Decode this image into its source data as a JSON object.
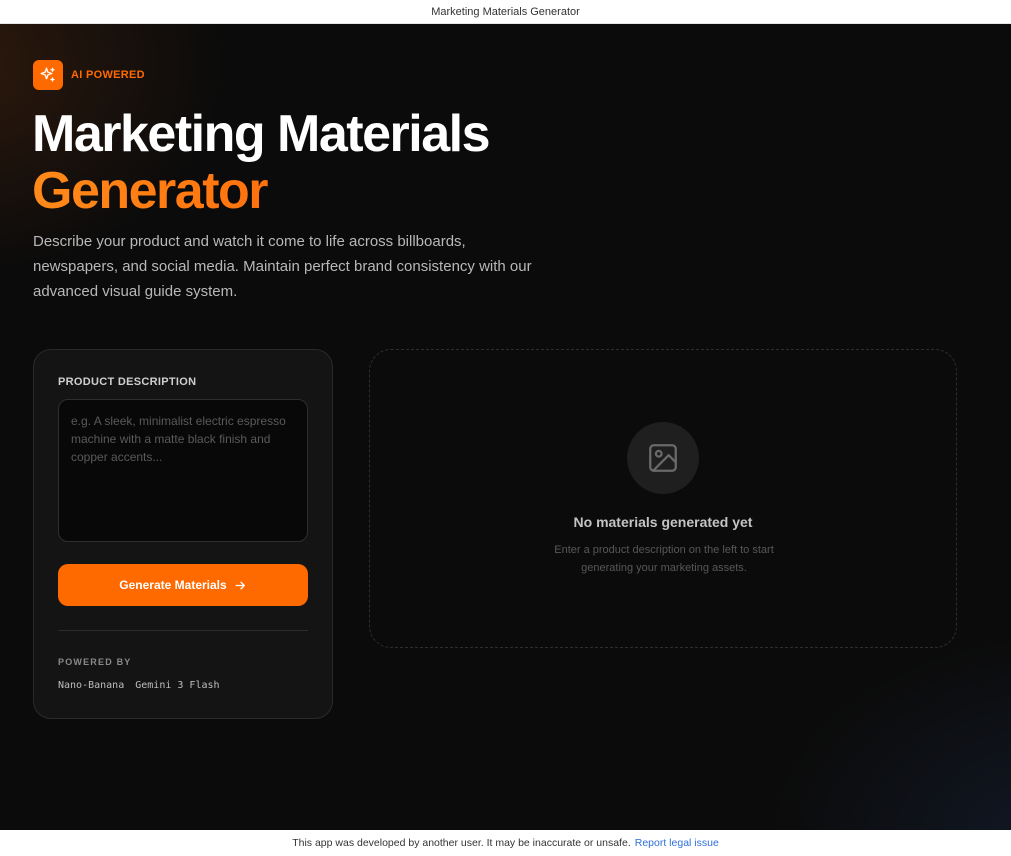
{
  "window": {
    "title": "Marketing Materials Generator"
  },
  "hero": {
    "badge_label": "AI POWERED",
    "badge_icon": "sparkles-icon",
    "title_line1": "Marketing Materials",
    "title_line2": "Generator",
    "subtitle": "Describe your product and watch it come to life across billboards, newspapers, and social media. Maintain perfect brand consistency with our advanced visual guide system."
  },
  "form": {
    "label": "PRODUCT DESCRIPTION",
    "value": "",
    "placeholder": "e.g. A sleek, minimalist electric espresso machine with a matte black finish and copper accents...",
    "button_label": "Generate Materials",
    "button_icon": "arrow-right-icon",
    "powered_label": "POWERED BY",
    "powered_items": [
      "Nano-Banana",
      "Gemini 3 Flash"
    ]
  },
  "output": {
    "empty_icon": "image-icon",
    "empty_title": "No materials generated yet",
    "empty_text": "Enter a product description on the left to start generating your marketing assets."
  },
  "footer": {
    "notice": "This app was developed by another user. It may be inaccurate or unsafe.",
    "link_label": "Report legal issue"
  },
  "colors": {
    "accent": "#ff6a00",
    "background": "#0b0b0b",
    "panel": "#141414",
    "link": "#2f6fdb"
  }
}
